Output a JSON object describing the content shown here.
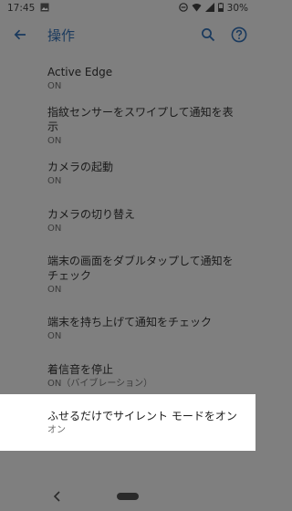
{
  "status_bar": {
    "time": "17:45",
    "battery": "30%",
    "icons": [
      "image-icon",
      "dnd-icon",
      "wifi-icon",
      "signal-icon",
      "battery-icon"
    ]
  },
  "app_bar": {
    "title": "操作",
    "icons": [
      "back-arrow-icon",
      "search-icon",
      "help-icon"
    ]
  },
  "settings": [
    {
      "title": "Active Edge",
      "summary": "ON"
    },
    {
      "title": "指紋センサーをスワイプして通知を表示",
      "summary": "ON"
    },
    {
      "title": "カメラの起動",
      "summary": "ON"
    },
    {
      "title": "カメラの切り替え",
      "summary": "ON"
    },
    {
      "title": "端末の画面をダブルタップして通知をチェック",
      "summary": "ON"
    },
    {
      "title": "端末を持ち上げて通知をチェック",
      "summary": "ON"
    },
    {
      "title": "着信音を停止",
      "summary": "ON（バイブレーション）"
    }
  ],
  "highlighted": {
    "title": "ふせるだけでサイレント モードをオン",
    "summary": "オン"
  },
  "colors": {
    "accent": "#1a3a5e",
    "dim_background": "#7f7f7f",
    "highlight_background": "#ffffff"
  }
}
